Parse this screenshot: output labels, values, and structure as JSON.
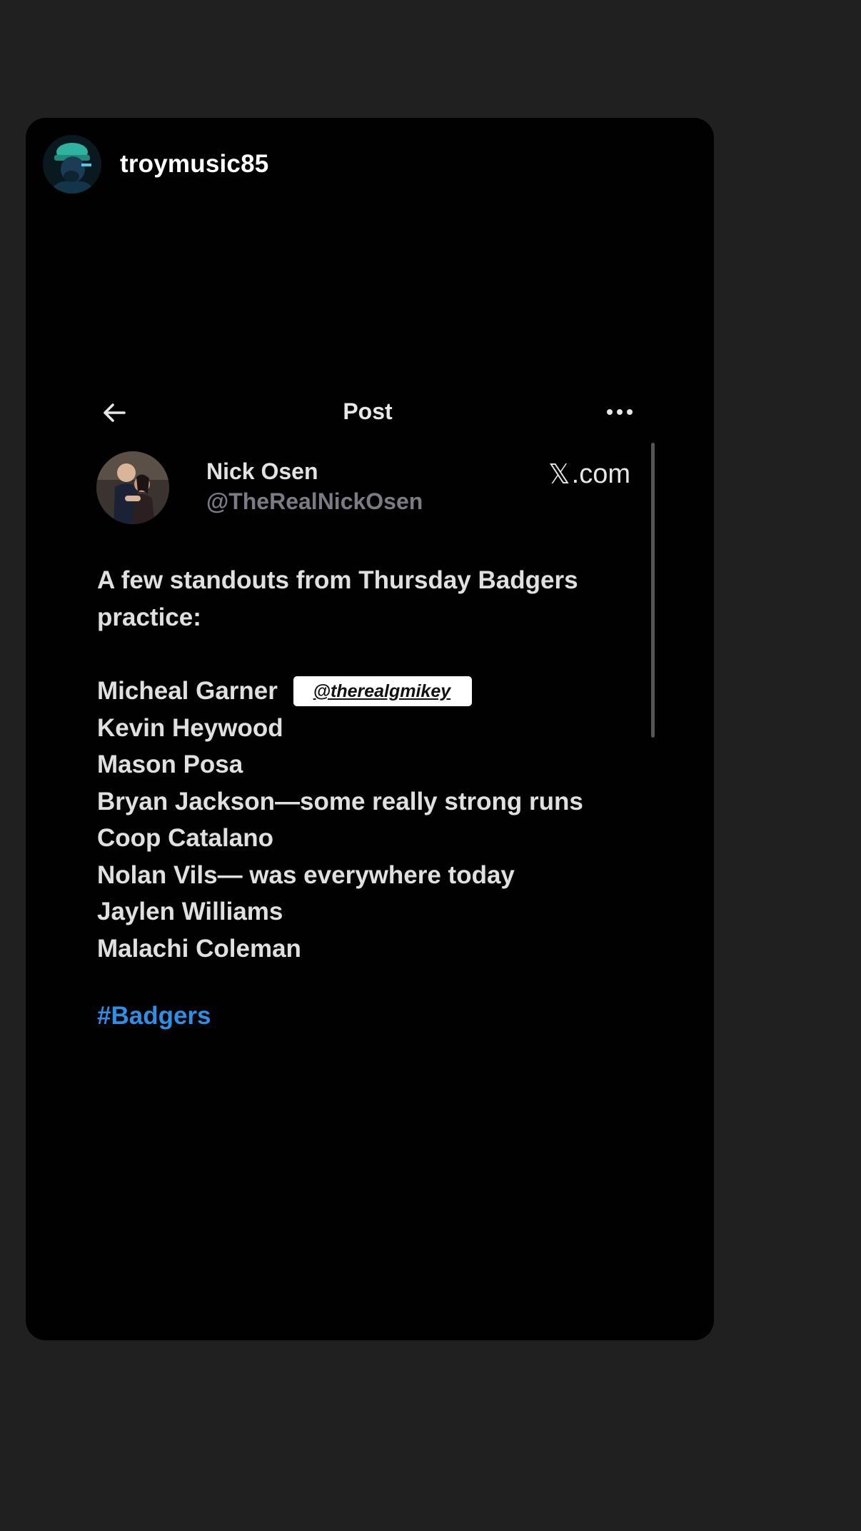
{
  "story": {
    "username": "troymusic85"
  },
  "post": {
    "title": "Post",
    "author_name": "Nick Osen",
    "author_handle": "@TheRealNickOsen",
    "source": ".com",
    "intro": "A few standouts from Thursday Badgers practice:",
    "lines": [
      "Micheal Garner",
      "Kevin Heywood",
      "Mason Posa",
      "Bryan Jackson—some really strong runs",
      "Coop Catalano",
      "Nolan Vils— was everywhere today",
      "Jaylen Williams",
      "Malachi Coleman"
    ],
    "mention_sticker": "@therealgmikey",
    "hashtag": "#Badgers"
  },
  "icons": {
    "back": "arrow-left-icon",
    "more": "more-horizontal-icon",
    "x_logo": "x-logo-icon"
  },
  "colors": {
    "background": "#202020",
    "card": "#010101",
    "hashtag": "#2f8ee6",
    "handle": "#7b7b86"
  }
}
